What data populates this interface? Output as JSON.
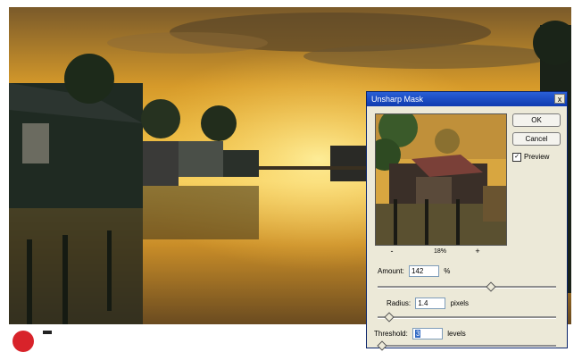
{
  "dialog": {
    "title": "Unsharp Mask",
    "close_glyph": "x",
    "ok_label": "OK",
    "cancel_label": "Cancel",
    "preview_label": "Preview",
    "preview_checked": true,
    "zoom_minus": "-",
    "zoom_plus": "+",
    "zoom_value": "18%",
    "amount": {
      "label": "Amount:",
      "value": "142",
      "unit": "%",
      "level": 0.63
    },
    "radius": {
      "label": "Radius:",
      "value": "1.4",
      "unit": "pixels",
      "level": 0.06
    },
    "threshold": {
      "label": "Threshold:",
      "value": "3",
      "unit": "levels",
      "level": 0.02
    }
  },
  "colors": {
    "accent_red": "#d8232a",
    "titlebar_blue": "#0f3bb0",
    "dialog_bg": "#ece9d8"
  }
}
